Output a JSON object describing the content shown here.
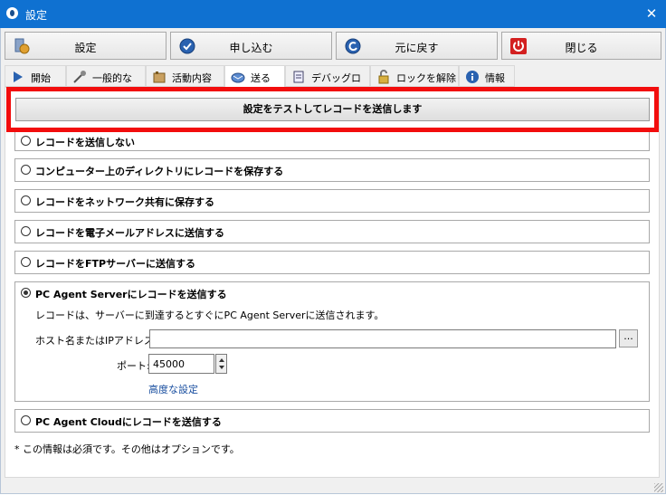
{
  "window": {
    "title": "設定"
  },
  "toolbar": {
    "settings_label": "設定",
    "load_label": "申し込む",
    "revert_label": "元に戻す",
    "close_label": "閉じる"
  },
  "tabs": [
    {
      "label": "開始"
    },
    {
      "label": "一般的な"
    },
    {
      "label": "活動内容"
    },
    {
      "label": "送る"
    },
    {
      "label": "デバッグログ"
    },
    {
      "label": "ロックを解除"
    },
    {
      "label": "情報"
    }
  ],
  "test_button_label": "設定をテストしてレコードを送信します",
  "options": {
    "no_send": "レコードを送信しない",
    "save_local": "コンピューター上のディレクトリにレコードを保存する",
    "save_network": "レコードをネットワーク共有に保存する",
    "send_email": "レコードを電子メールアドレスに送信する",
    "send_ftp": "レコードをFTPサーバーに送信する",
    "send_server": "PC Agent Serverにレコードを送信する",
    "send_cloud": "PC Agent Cloudにレコードを送信する"
  },
  "server": {
    "description": "レコードは、サーバーに到達するとすぐにPC Agent Serverに送信されます。",
    "host_label": "ホスト名またはIPアドレス*:",
    "host_value": "",
    "browse_label": "...",
    "port_label": "ポート:",
    "port_value": "45000",
    "advanced_link": "高度な設定"
  },
  "footnote": "* この情報は必須です。その他はオプションです。",
  "colors": {
    "titlebar": "#0f71d1",
    "highlight": "#f20d0d",
    "link": "#1a4fa0"
  }
}
